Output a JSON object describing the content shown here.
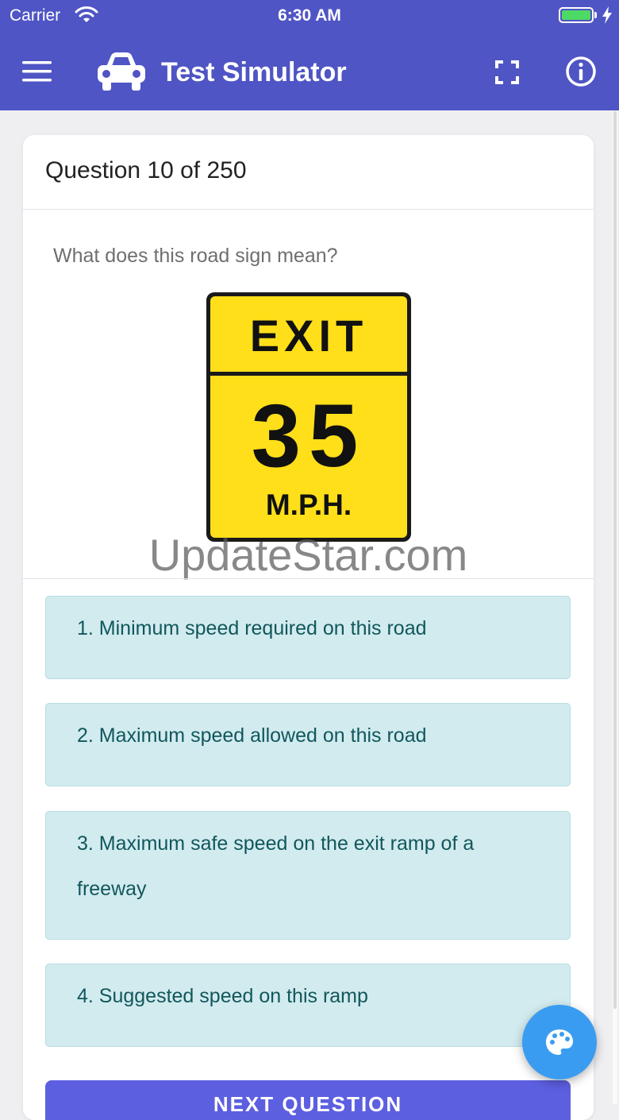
{
  "status_bar": {
    "carrier": "Carrier",
    "time": "6:30 AM",
    "battery_color": "#4cd964"
  },
  "header": {
    "title": "Test Simulator",
    "menu_icon": "hamburger-menu-icon",
    "logo_icon": "car-icon",
    "fullscreen_icon": "fullscreen-icon",
    "info_icon": "info-icon",
    "background": "#4f55c4"
  },
  "question": {
    "counter": "Question 10 of 250",
    "text": "What does this road sign mean?",
    "sign": {
      "top_text": "EXIT",
      "number": "35",
      "unit": "M.P.H.",
      "color": "#ffdf1a"
    },
    "watermark": "UpdateStar.com"
  },
  "answers": [
    {
      "label": "1. Minimum speed required on this road"
    },
    {
      "label": "2. Maximum speed allowed on this road"
    },
    {
      "label": "3. Maximum safe speed on the exit ramp of a freeway"
    },
    {
      "label": "4. Suggested speed on this ramp"
    }
  ],
  "next_button": {
    "label": "NEXT QUESTION"
  },
  "fab": {
    "icon": "palette-icon",
    "color": "#3a9cf0"
  }
}
